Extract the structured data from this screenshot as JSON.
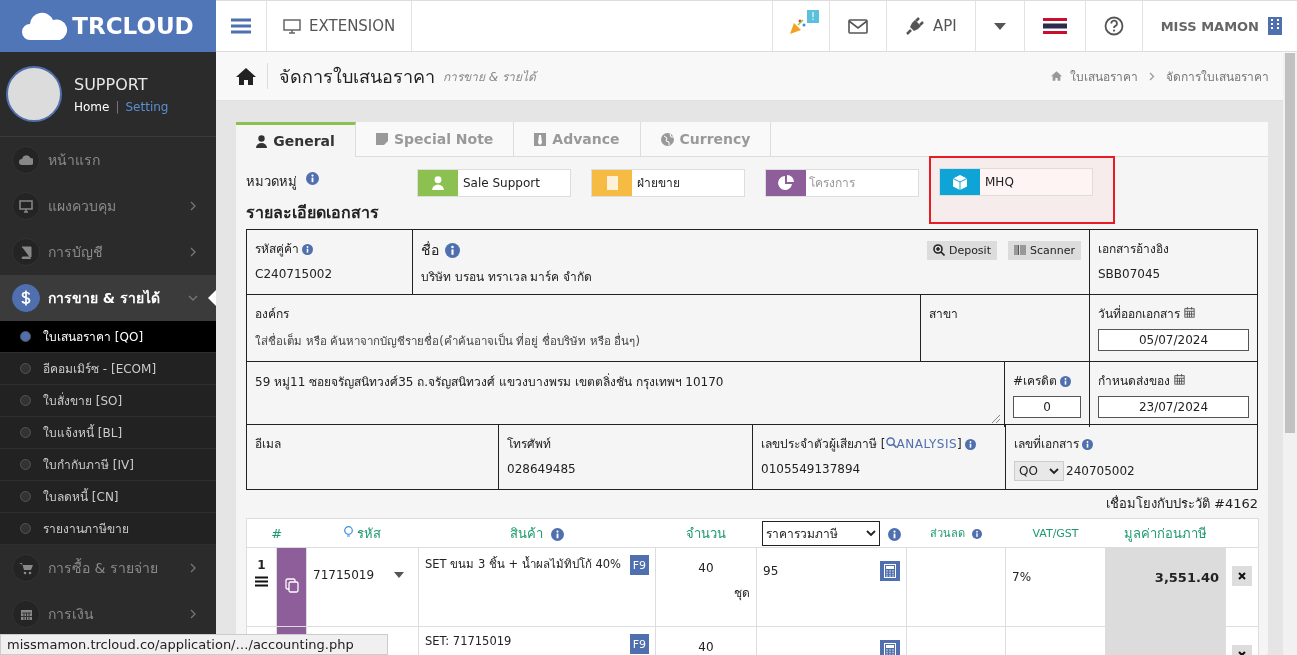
{
  "logo": {
    "text": "TRCLOUD"
  },
  "profile": {
    "name": "SUPPORT",
    "separator": "|",
    "links": [
      {
        "label": "Home",
        "selected": true
      },
      {
        "label": "Setting",
        "selected": false
      }
    ]
  },
  "sidebar": {
    "items": [
      {
        "label": "หน้าแรก",
        "kind": "link",
        "expanded": false
      },
      {
        "label": "แผงควบคุม",
        "kind": "menu",
        "expanded": false
      },
      {
        "label": "การบัญชี",
        "kind": "menu",
        "expanded": false
      },
      {
        "label": "การขาย & รายได้",
        "kind": "menu",
        "expanded": true,
        "children": [
          {
            "label": "ใบเสนอราคา [QO]",
            "selected": true
          },
          {
            "label": "อีคอมเมิร์ซ - [ECOM]",
            "selected": false
          },
          {
            "label": "ใบสั่งขาย [SO]",
            "selected": false
          },
          {
            "label": "ใบแจ้งหนี้ [BL]",
            "selected": false
          },
          {
            "label": "ใบกำกับภาษี [IV]",
            "selected": false
          },
          {
            "label": "ใบลดหนี้ [CN]",
            "selected": false
          },
          {
            "label": "รายงานภาษีขาย",
            "selected": false
          }
        ]
      },
      {
        "label": "การซื้อ & รายจ่าย",
        "kind": "menu",
        "expanded": false
      },
      {
        "label": "การเงิน",
        "kind": "menu",
        "expanded": false
      }
    ]
  },
  "topbar": {
    "extension": "EXTENSION",
    "badge": "!",
    "api": "API",
    "user": "MISS MAMON"
  },
  "header": {
    "title": "จัดการใบเสนอราคา",
    "subtitle": "การขาย & รายได้",
    "breadcrumb": [
      "ใบเสนอราคา",
      "จัดการใบเสนอราคา"
    ]
  },
  "tabs": [
    {
      "label": "General",
      "selected": true
    },
    {
      "label": "Special Note",
      "selected": false
    },
    {
      "label": "Advance",
      "selected": false
    },
    {
      "label": "Currency",
      "selected": false
    }
  ],
  "category": {
    "label": "หมวดหมู่",
    "fields": [
      {
        "value": "Sale Support",
        "color": "#8cc152",
        "highlighted": false
      },
      {
        "value": "ฝ่ายขาย",
        "color": "#f6bb42",
        "highlighted": false
      },
      {
        "placeholder": "โครงการ",
        "color": "#8e5e9b",
        "highlighted": false
      },
      {
        "value": "MHQ",
        "color": "#0ea5d6",
        "highlighted": true
      }
    ]
  },
  "section_title": "รายละเอียดเอกสาร",
  "doc": {
    "customer_code": {
      "label": "รหัสคู่ค้า",
      "value": "C240715002"
    },
    "name": {
      "label": "ชื่อ",
      "value": "บริษัท บรอน ทราเวล มาร์ค จำกัด"
    },
    "buttons": [
      "Deposit",
      "Scanner"
    ],
    "reference": {
      "label": "เอกสารอ้างอิง",
      "value": "SBB07045"
    },
    "organization": {
      "label": "องค์กร",
      "placeholder": "ใส่ชื่อเต็ม หรือ ค้นหาจากบัญชีรายชื่อ(คำค้นอาจเป็น ที่อยู่ ชื่อบริษัท หรือ อื่นๆ)"
    },
    "branch": {
      "label": "สาขา"
    },
    "issue_date": {
      "label": "วันที่ออกเอกสาร",
      "value": "05/07/2024"
    },
    "address": {
      "value": "59 หมู่11 ซอยจรัญสนิทวงศ์35 ถ.จรัญสนิทวงศ์ แขวงบางพรม เขตตลิ่งชัน กรุงเทพฯ 10170"
    },
    "credit": {
      "label": "#เครดิต",
      "value": "0"
    },
    "delivery_date": {
      "label": "กำหนดส่งของ",
      "value": "23/07/2024"
    },
    "email": {
      "label": "อีเมล"
    },
    "phone": {
      "label": "โทรศัพท์",
      "value": "028649485"
    },
    "tax_id": {
      "label": "เลขประจำตัวผู้เสียภาษี [",
      "link": "ANALYSIS",
      "label_end": "]",
      "value": "0105549137894"
    },
    "doc_number": {
      "label": "เลขที่เอกสาร",
      "prefix": "QO",
      "value": "240705002"
    }
  },
  "history_link": "เชื่อมโยงกับประวัติ #4162",
  "items": {
    "columns": [
      "#",
      "รหัส",
      "สินค้า",
      "จำนวน",
      "ราคารวมภาษี",
      "ส่วนลด",
      "VAT/GST",
      "มูลค่าก่อนภาษี"
    ],
    "rows": [
      {
        "no": "1",
        "code": "71715019",
        "product": "SET ขนม 3 ชิ้น + น้ำผลไม้ทิปโก้ 40%",
        "key": "F9",
        "qty": "40",
        "unit": "ชุด",
        "price": "95",
        "vat": "7%",
        "amount": "3,551.40"
      },
      {
        "product": "SET: 71715019",
        "key": "F9",
        "qty": "40"
      }
    ]
  },
  "status_bar": "missmamon.trcloud.co/application/…/accounting.php"
}
